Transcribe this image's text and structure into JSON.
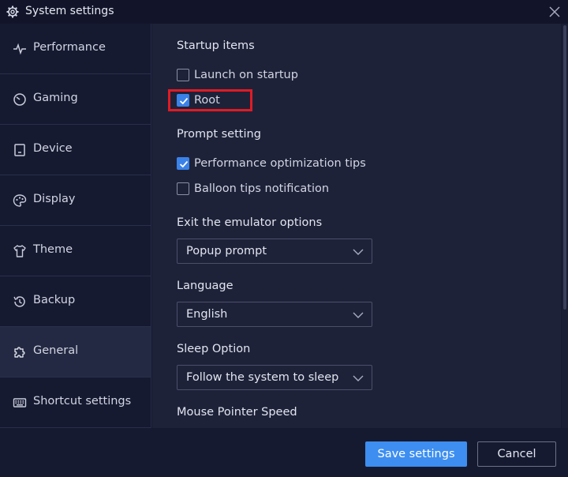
{
  "window": {
    "title": "System settings"
  },
  "sidebar": {
    "items": [
      {
        "label": "Performance",
        "icon": "activity-icon"
      },
      {
        "label": "Gaming",
        "icon": "gauge-icon"
      },
      {
        "label": "Device",
        "icon": "phone-icon"
      },
      {
        "label": "Display",
        "icon": "palette-icon"
      },
      {
        "label": "Theme",
        "icon": "shirt-icon"
      },
      {
        "label": "Backup",
        "icon": "history-icon"
      },
      {
        "label": "General",
        "icon": "puzzle-icon",
        "active": true
      },
      {
        "label": "Shortcut settings",
        "icon": "keyboard-icon"
      }
    ]
  },
  "general": {
    "startup": {
      "title": "Startup items",
      "launch_on_startup": {
        "label": "Launch on startup",
        "checked": false
      },
      "root": {
        "label": "Root",
        "checked": true
      }
    },
    "prompt": {
      "title": "Prompt setting",
      "perf_tips": {
        "label": "Performance optimization tips",
        "checked": true
      },
      "balloon_tips": {
        "label": "Balloon tips notification",
        "checked": false
      }
    },
    "exit_options": {
      "title": "Exit the emulator options",
      "value": "Popup prompt"
    },
    "language": {
      "title": "Language",
      "value": "English"
    },
    "sleep": {
      "title": "Sleep Option",
      "value": "Follow the system to sleep"
    },
    "mouse_speed": {
      "title": "Mouse Pointer Speed"
    }
  },
  "footer": {
    "save_label": "Save settings",
    "cancel_label": "Cancel"
  },
  "colors": {
    "accent": "#3d8ef0",
    "highlight": "#e01b24",
    "background": "#1e2239",
    "sidebar": "#161a31"
  }
}
